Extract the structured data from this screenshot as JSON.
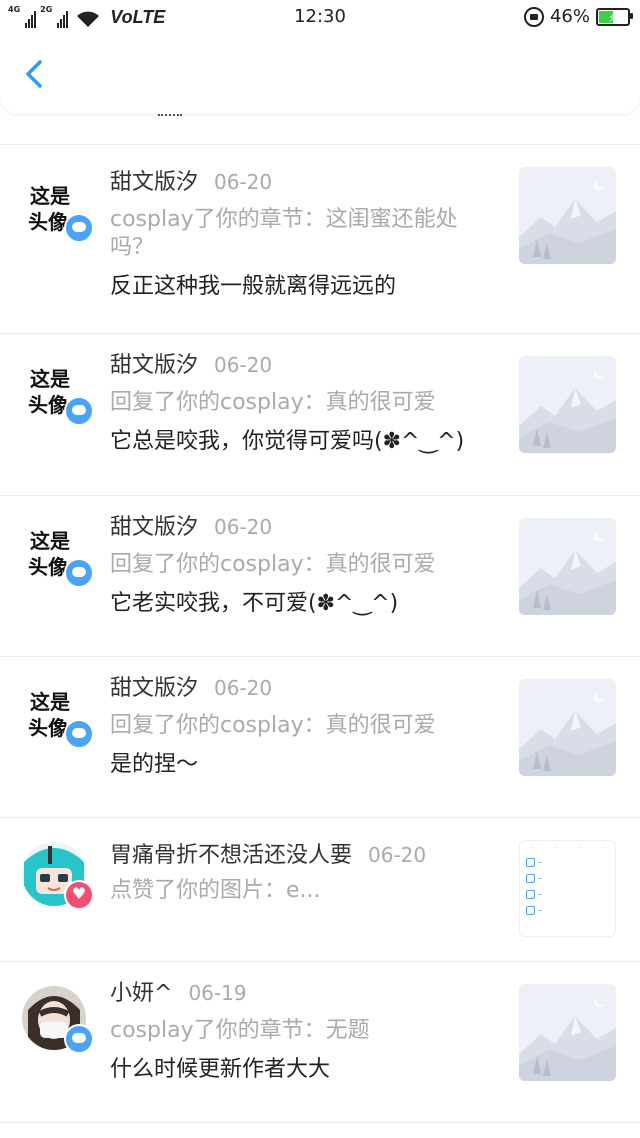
{
  "status_bar": {
    "sim1": "4G",
    "sim2": "2G",
    "network": "VoLTE",
    "time": "12:30",
    "battery": "46%",
    "battery_level": 0.46,
    "battery_color": "#3dd14a",
    "icons": [
      "signal-icon",
      "wifi-icon",
      "lock-rotation-icon",
      "battery-icon"
    ]
  },
  "header": {
    "back_icon": "chevron-left-icon",
    "accent": "#2f9bf0"
  },
  "notifications": [
    {
      "user": "甜文版汐",
      "date": "06-20",
      "action": "cosplay了你的章节：这闺蜜还能处吗？",
      "content": "反正这种我一般就离得远远的",
      "badge": "message",
      "thumb": "mountain-placeholder"
    },
    {
      "user": "甜文版汐",
      "date": "06-20",
      "action": "回复了你的cosplay：真的很可爱",
      "content": "它总是咬我，你觉得可爱吗(✽^‿^)",
      "badge": "message",
      "thumb": "mountain-placeholder"
    },
    {
      "user": "甜文版汐",
      "date": "06-20",
      "action": "回复了你的cosplay：真的很可爱",
      "content": "它老实咬我，不可爱(✽^‿^)",
      "badge": "message",
      "thumb": "mountain-placeholder"
    },
    {
      "user": "甜文版汐",
      "date": "06-20",
      "action": "回复了你的cosplay：真的很可爱",
      "content": "是的捏～",
      "badge": "message",
      "thumb": "mountain-placeholder"
    },
    {
      "user": "胃痛骨折不想活还没人要",
      "date": "06-20",
      "action": "点赞了你的图片：e...",
      "content": "",
      "badge": "like",
      "thumb": "screenshot"
    },
    {
      "user": "小妍^",
      "date": "06-19",
      "action": "cosplay了你的章节：无题",
      "content": "什么时候更新作者大大",
      "badge": "message",
      "thumb": "mountain-placeholder"
    }
  ],
  "avatar_text": {
    "top": "这是",
    "bottom": "头像"
  },
  "colors": {
    "badge_message": "#4aa3f7",
    "badge_like": "#f14f74",
    "muted_text": "#aaaaaa"
  }
}
